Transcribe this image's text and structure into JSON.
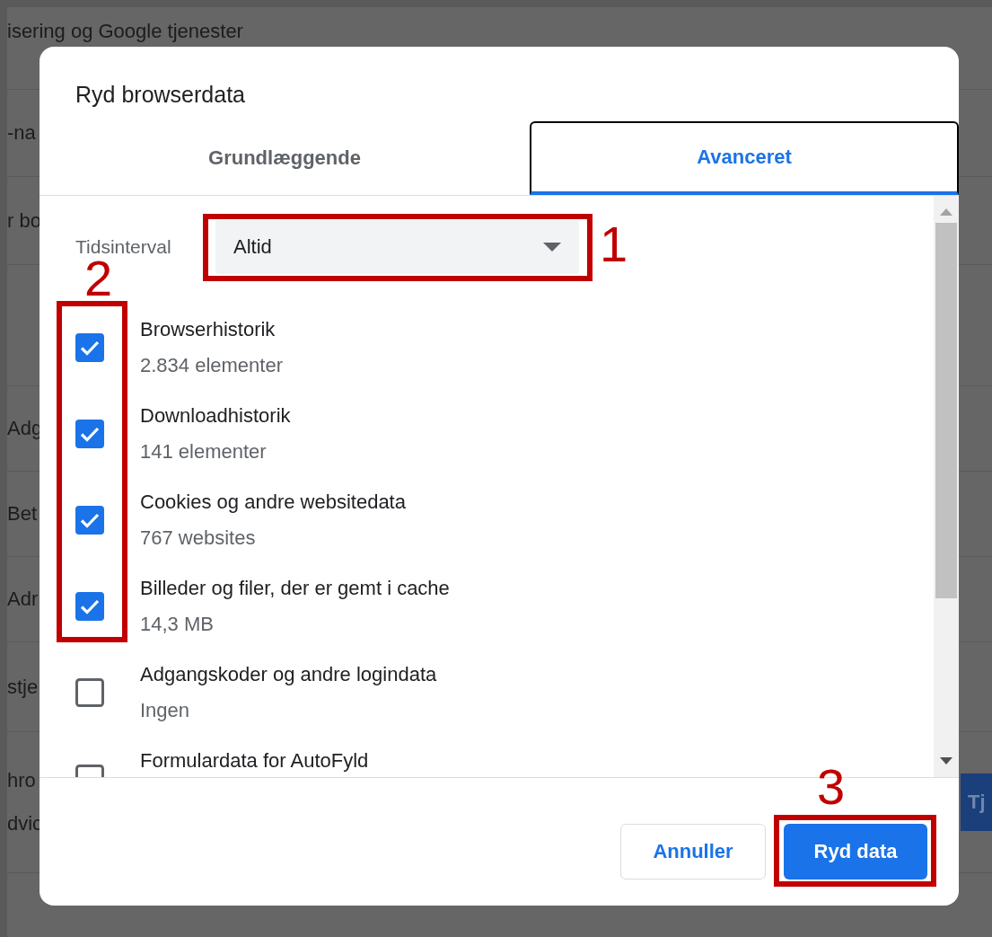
{
  "background": {
    "rows": [
      {
        "lines": [
          "isering og Google tjenester"
        ]
      },
      {
        "lines": [
          "-na"
        ]
      },
      {
        "lines": [
          "r bo"
        ]
      },
      {
        "lines": [
          "Adg"
        ]
      },
      {
        "lines": [
          "Bet"
        ]
      },
      {
        "lines": [
          "Adr"
        ]
      },
      {
        "lines": [
          "stje"
        ]
      },
      {
        "lines": [
          "hro",
          "dvic"
        ]
      }
    ],
    "button": "Tj"
  },
  "dialog": {
    "title": "Ryd browserdata",
    "tabs": [
      {
        "label": "Grundlæggende",
        "selected": false
      },
      {
        "label": "Avanceret",
        "selected": true
      }
    ],
    "time_range": {
      "label": "Tidsinterval",
      "value": "Altid"
    },
    "items": [
      {
        "title": "Browserhistorik",
        "detail": "2.834 elementer",
        "checked": true
      },
      {
        "title": "Downloadhistorik",
        "detail": "141 elementer",
        "checked": true
      },
      {
        "title": "Cookies og andre websitedata",
        "detail": "767 websites",
        "checked": true
      },
      {
        "title": "Billeder og filer, der er gemt i cache",
        "detail": "14,3 MB",
        "checked": true
      },
      {
        "title": "Adgangskoder og andre logindata",
        "detail": "Ingen",
        "checked": false
      },
      {
        "title": "Formulardata for AutoFyld",
        "checked": false
      }
    ],
    "buttons": [
      {
        "label": "Annuller",
        "kind": "secondary"
      },
      {
        "label": "Ryd data",
        "kind": "primary"
      }
    ]
  },
  "annotations": [
    {
      "number": "1"
    },
    {
      "number": "2"
    },
    {
      "number": "3"
    }
  ]
}
